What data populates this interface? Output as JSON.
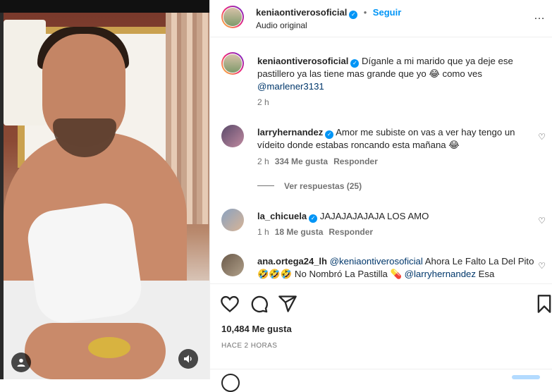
{
  "post": {
    "author": "keniaontiverosoficial",
    "follow_label": "Seguir",
    "audio": "Audio original",
    "caption_parts": [
      "Díganle a mi marido que ya deje ese pastillero ya las tiene mas grande que yo ",
      "😂",
      " como ves "
    ],
    "caption_mention": "@marlener3131",
    "caption_time": "2 h",
    "likes": "10,484 Me gusta",
    "posted_ago": "HACE 2 HORAS"
  },
  "comments": [
    {
      "user": "larryhernandez",
      "verified": true,
      "text": "Amor me subiste on vas a ver hay tengo un vídeito donde estabas roncando esta mañana 😂",
      "time": "2 h",
      "likes": "334 Me gusta",
      "reply": "Responder",
      "view_replies": "Ver respuestas (25)"
    },
    {
      "user": "la_chicuela",
      "verified": true,
      "text": "JAJAJAJAJAJA LOS AMO",
      "time": "1 h",
      "likes": "18 Me gusta",
      "reply": "Responder"
    },
    {
      "user": "ana.ortega24_lh",
      "verified": false,
      "mention1": "@keniaontiverosoficial",
      "text_a": " Ahora Le Falto La Del Pito 🤣🤣🤣 No Nombró La Pastilla 💊 ",
      "mention2": "@larryhernandez",
      "text_b": " Esa"
    }
  ],
  "icons": [
    "heart-icon",
    "comment-icon",
    "share-icon",
    "bookmark-icon",
    "mute-icon",
    "user-tag-icon",
    "more-icon",
    "verified-badge"
  ],
  "colors": {
    "accent": "#0095f6",
    "text": "#262626",
    "muted": "#737373",
    "border": "#efefef"
  }
}
